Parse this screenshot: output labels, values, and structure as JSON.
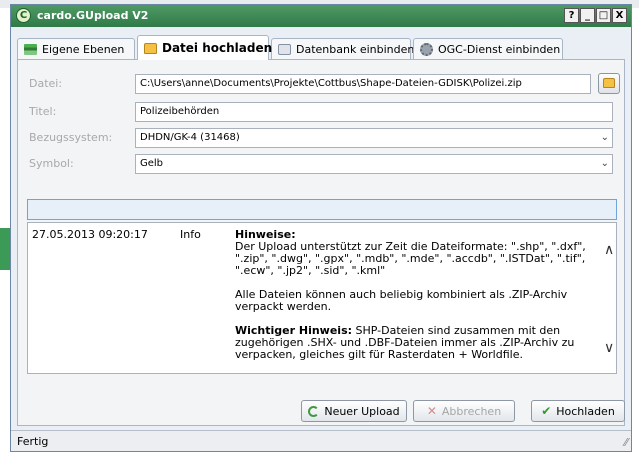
{
  "window": {
    "title": "cardo.GUpload V2",
    "controls": [
      "?",
      "_",
      "□",
      "X"
    ]
  },
  "tabs": [
    {
      "label": "Eigene Ebenen",
      "icon": "layers-icon",
      "active": false
    },
    {
      "label": "Datei hochladen",
      "icon": "folder-icon",
      "active": true
    },
    {
      "label": "Datenbank einbinden",
      "icon": "database-icon",
      "active": false
    },
    {
      "label": "OGC-Dienst einbinden",
      "icon": "gear-icon",
      "active": false
    }
  ],
  "form": {
    "file_label": "Datei:",
    "file_value": "C:\\Users\\anne\\Documents\\Projekte\\Cottbus\\Shape-Dateien-GDISK\\Polizei.zip",
    "title_label": "Titel:",
    "title_value": "Polizeibehörden",
    "crs_label": "Bezugssystem:",
    "crs_value": "DHDN/GK-4 (31468)",
    "symbol_label": "Symbol:",
    "symbol_value": "Gelb"
  },
  "log": {
    "timestamp": "27.05.2013 09:20:17",
    "level": "Info",
    "heading": "Hinweise:",
    "para1": "Der Upload unterstützt zur Zeit die Dateiformate: \".shp\", \".dxf\", \".zip\", \".dwg\", \".gpx\", \".mdb\", \".mde\", \".accdb\", \".ISTDat\", \".tif\", \".ecw\", \".jp2\", \".sid\", \".kml\"",
    "para2": "Alle Dateien können auch beliebig kombiniert als .ZIP-Archiv verpackt werden.",
    "para3_bold": "Wichtiger Hinweis:",
    "para3": " SHP-Dateien sind zusammen mit den zugehörigen .SHX- und .DBF-Dateien immer als .ZIP-Archiv zu verpacken, gleiches gilt für Rasterdaten + Worldfile."
  },
  "buttons": {
    "new_upload": "Neuer Upload",
    "cancel": "Abbrechen",
    "upload": "Hochladen"
  },
  "status": {
    "text": "Fertig"
  },
  "colors": {
    "titlebar": "#3f8a55",
    "progress_border": "#6fa3d9"
  }
}
